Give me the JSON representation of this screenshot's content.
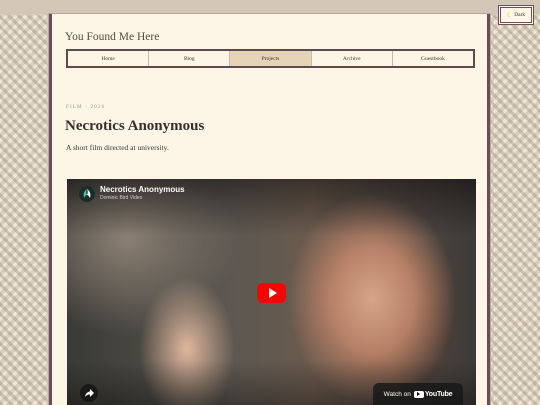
{
  "site": {
    "title": "You Found Me Here"
  },
  "nav": {
    "items": [
      {
        "label": "Home"
      },
      {
        "label": "Blog"
      },
      {
        "label": "Projects",
        "active": true
      },
      {
        "label": "Archive"
      },
      {
        "label": "Guestbook"
      }
    ]
  },
  "theme_toggle": {
    "label": "Dark",
    "icon": "moon-icon"
  },
  "post": {
    "eyebrow": "FILM · 2026",
    "title": "Necrotics Anonymous",
    "description": "A short film directed at university."
  },
  "video": {
    "title": "Necrotics Anonymous",
    "channel": "Dominic Bird Video",
    "watch_on": "Watch on",
    "platform": "YouTube"
  },
  "colors": {
    "accent_border": "#6b4f57",
    "page_background": "#fdf6e6",
    "active_nav": "#e5d4b6",
    "play_button": "#ff0000"
  }
}
